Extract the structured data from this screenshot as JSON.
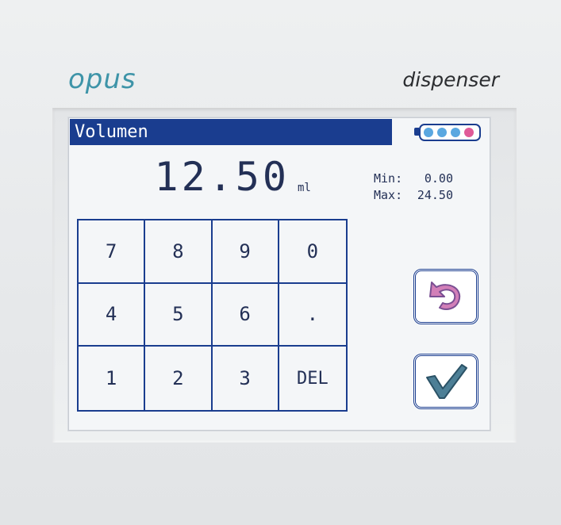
{
  "device": {
    "brand": "opus",
    "product": "dispenser"
  },
  "screen": {
    "title": "Volumen",
    "value": "12.50",
    "unit": "ml",
    "limits": {
      "min_label": "Min:",
      "min_value": "0.00",
      "max_label": "Max:",
      "max_value": "24.50"
    },
    "battery": {
      "cells": [
        "#5aa7e0",
        "#5aa7e0",
        "#5aa7e0",
        "#e05a98"
      ]
    },
    "keypad": [
      "7",
      "8",
      "9",
      "0",
      "4",
      "5",
      "6",
      ".",
      "1",
      "2",
      "3",
      "DEL"
    ],
    "buttons": {
      "undo_icon": "undo-arrow-icon",
      "confirm_icon": "checkmark-icon"
    }
  },
  "colors": {
    "brand": "#3e94a8",
    "title_bar": "#1a3d8f",
    "undo_arrow": "#d27fb8",
    "checkmark": "#4d7f96"
  }
}
